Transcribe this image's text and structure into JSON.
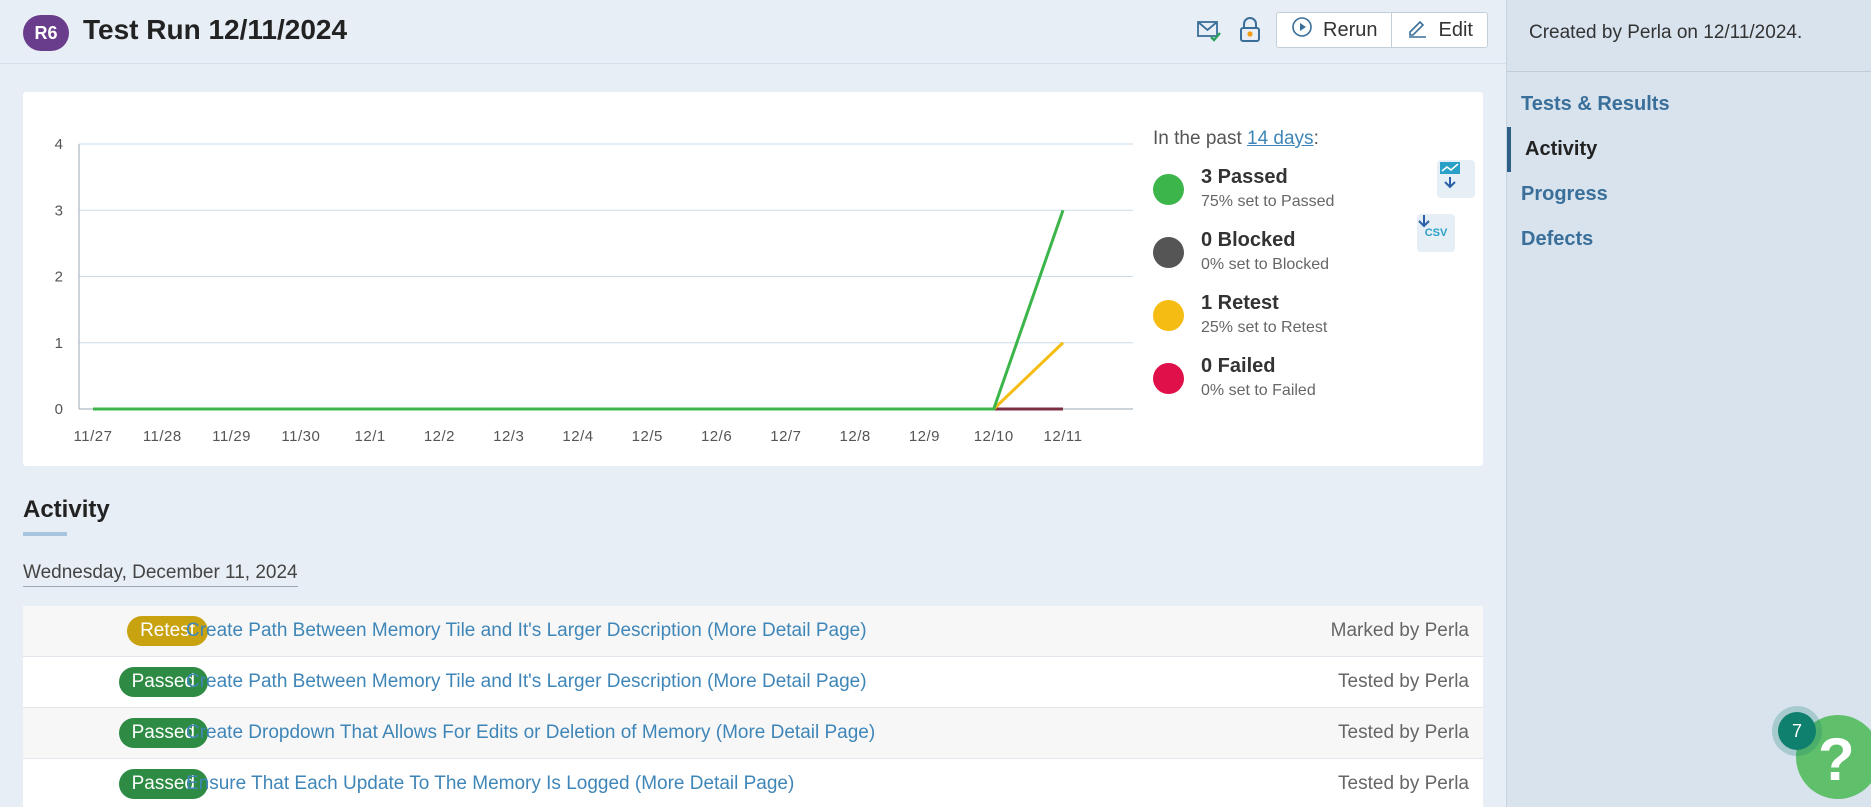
{
  "header": {
    "badge": "R6",
    "title": "Test Run 12/11/2024",
    "rerun_label": "Rerun",
    "edit_label": "Edit"
  },
  "legend": {
    "prefix": "In the past ",
    "period_link": "14 days",
    "suffix": ":",
    "items": [
      {
        "count": "3 Passed",
        "sub": "75% set to Passed",
        "color": "#3cb54a"
      },
      {
        "count": "0 Blocked",
        "sub": "0% set to Blocked",
        "color": "#555555"
      },
      {
        "count": "1 Retest",
        "sub": "25% set to Retest",
        "color": "#f5bd13"
      },
      {
        "count": "0 Failed",
        "sub": "0% set to Failed",
        "color": "#e0104a"
      }
    ],
    "csv_label": "CSV"
  },
  "chart_data": {
    "type": "line",
    "x": [
      "11/27",
      "11/28",
      "11/29",
      "11/30",
      "12/1",
      "12/2",
      "12/3",
      "12/4",
      "12/5",
      "12/6",
      "12/7",
      "12/8",
      "12/9",
      "12/10",
      "12/11"
    ],
    "ylim": [
      0,
      4
    ],
    "yticks": [
      "0",
      "1",
      "2",
      "3",
      "4"
    ],
    "grid": true,
    "series": [
      {
        "name": "Passed",
        "color": "#3cb54a",
        "values": [
          0,
          0,
          0,
          0,
          0,
          0,
          0,
          0,
          0,
          0,
          0,
          0,
          0,
          0,
          3
        ]
      },
      {
        "name": "Retest",
        "color": "#f5bd13",
        "values": [
          0,
          0,
          0,
          0,
          0,
          0,
          0,
          0,
          0,
          0,
          0,
          0,
          0,
          0,
          1
        ]
      },
      {
        "name": "Failed",
        "color": "#7a3040",
        "values": [
          0,
          0,
          0,
          0,
          0,
          0,
          0,
          0,
          0,
          0,
          0,
          0,
          0,
          0,
          0
        ]
      }
    ]
  },
  "activity": {
    "title": "Activity",
    "date": "Wednesday, December 11, 2024",
    "rows": [
      {
        "status": "Retest",
        "status_color": "#c9a20f",
        "text": "Create Path Between Memory Tile and It's Larger Description (More Detail Page)",
        "by": "Marked by Perla"
      },
      {
        "status": "Passed",
        "status_color": "#2e8b43",
        "text": "Create Path Between Memory Tile and It's Larger Description (More Detail Page)",
        "by": "Tested by Perla"
      },
      {
        "status": "Passed",
        "status_color": "#2e8b43",
        "text": "Create Dropdown That Allows For Edits or Deletion of Memory (More Detail Page)",
        "by": "Tested by Perla"
      },
      {
        "status": "Passed",
        "status_color": "#2e8b43",
        "text": "Ensure That Each Update To The Memory Is Logged (More Detail Page)",
        "by": "Tested by Perla"
      }
    ]
  },
  "sidebar": {
    "meta": "Created by Perla on 12/11/2024.",
    "items": [
      {
        "label": "Tests & Results",
        "active": false
      },
      {
        "label": "Activity",
        "active": true
      },
      {
        "label": "Progress",
        "active": false
      },
      {
        "label": "Defects",
        "active": false
      }
    ]
  },
  "help": {
    "count": "7",
    "glyph": "?"
  }
}
